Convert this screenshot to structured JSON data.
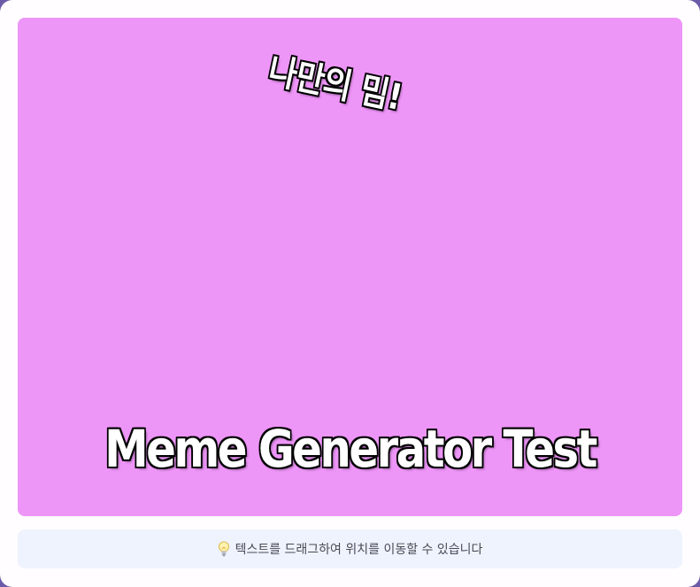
{
  "canvas": {
    "background_color": "#ee95f8",
    "top_text": "나만의 밈!",
    "bottom_text": "Meme Generator Test"
  },
  "hint": {
    "icon": "lightbulb-icon",
    "text": "텍스트를 드래그하여 위치를 이동할 수 있습니다"
  }
}
